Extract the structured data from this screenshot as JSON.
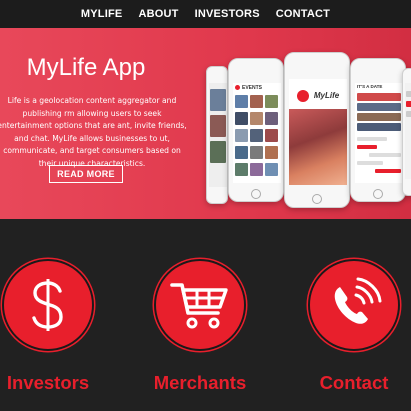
{
  "nav": {
    "items": [
      {
        "label": "MYLIFE"
      },
      {
        "label": "ABOUT"
      },
      {
        "label": "INVESTORS"
      },
      {
        "label": "CONTACT"
      }
    ]
  },
  "hero": {
    "title": "MyLife App",
    "body": "Life is a geolocation content aggregator and publishing rm allowing users to seek entertainment options that are ant, invite friends, and chat.  MyLife allows businesses to ut, communicate, and target consumers based on their unique characteristics.",
    "cta_label": "READ MORE",
    "phone_screens": {
      "events_title": "EVENTS",
      "logo_text": "MyLife",
      "date_title": "IT'S A DATE"
    }
  },
  "features": [
    {
      "label": "Investors",
      "icon": "dollar-icon"
    },
    {
      "label": "Merchants",
      "icon": "shopping-cart-icon"
    },
    {
      "label": "Contact",
      "icon": "phone-icon"
    }
  ],
  "colors": {
    "accent": "#e81f2c",
    "hero_bg": "#e0384c",
    "nav_bg": "#1c1c1c",
    "page_bg": "#212121"
  }
}
